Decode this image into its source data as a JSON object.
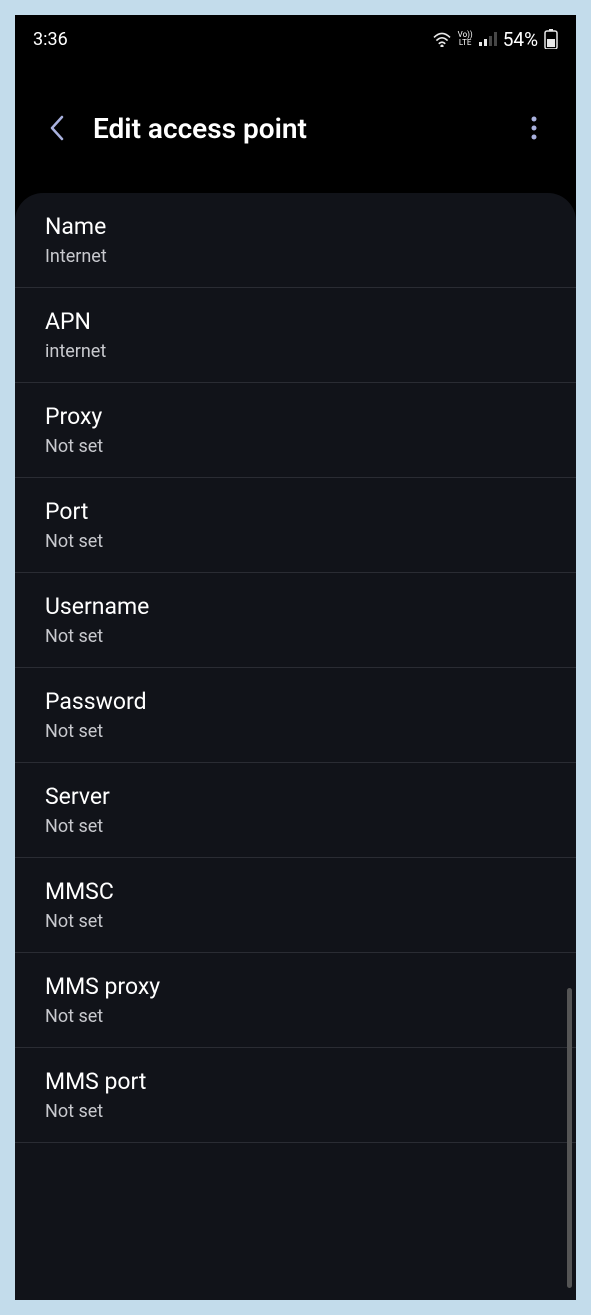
{
  "status": {
    "time": "3:36",
    "battery": "54%"
  },
  "header": {
    "title": "Edit access point"
  },
  "settings": [
    {
      "label": "Name",
      "value": "Internet"
    },
    {
      "label": "APN",
      "value": "internet"
    },
    {
      "label": "Proxy",
      "value": "Not set"
    },
    {
      "label": "Port",
      "value": "Not set"
    },
    {
      "label": "Username",
      "value": "Not set"
    },
    {
      "label": "Password",
      "value": "Not set"
    },
    {
      "label": "Server",
      "value": "Not set"
    },
    {
      "label": "MMSC",
      "value": "Not set"
    },
    {
      "label": "MMS proxy",
      "value": "Not set"
    },
    {
      "label": "MMS port",
      "value": "Not set"
    }
  ]
}
